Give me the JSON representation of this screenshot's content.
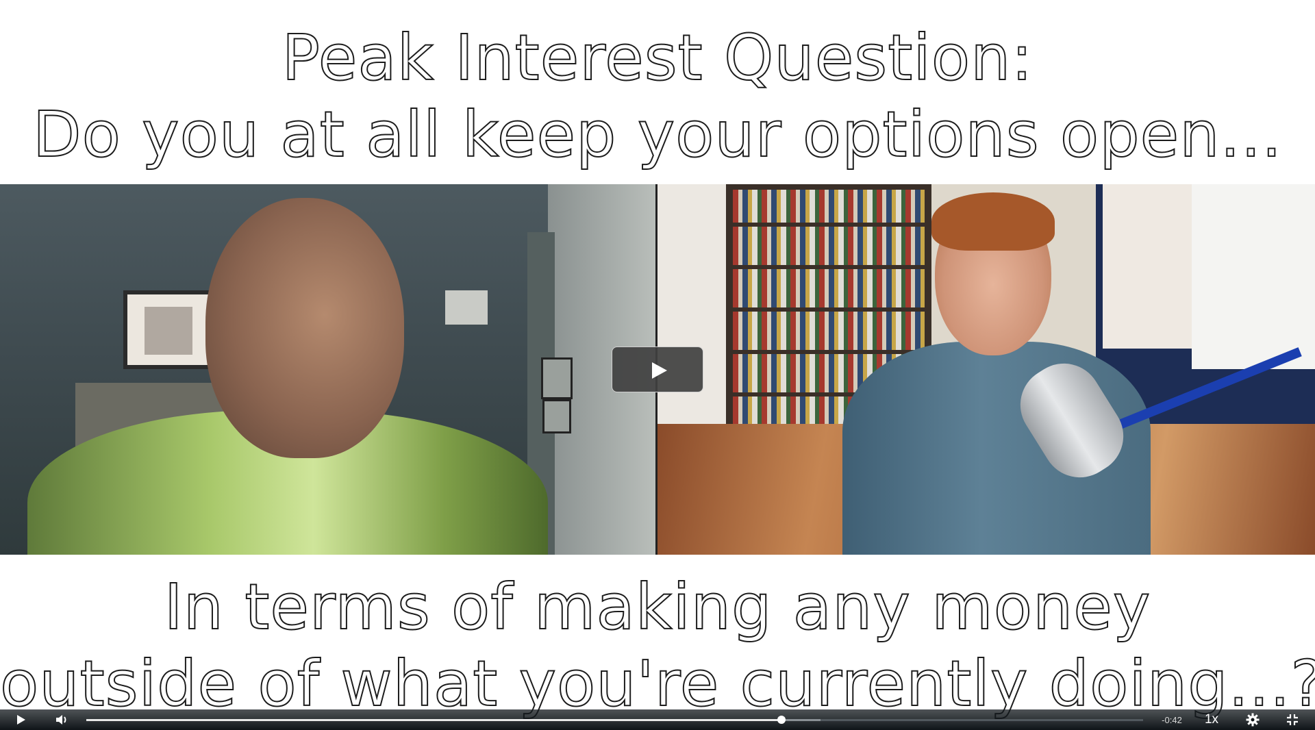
{
  "slide": {
    "title_line1": "Peak Interest Question:",
    "title_line2": "Do you at all keep your options open...",
    "caption_line1": "In terms of making any money",
    "caption_line2": "outside of what you're currently doing...?"
  },
  "player": {
    "big_play_icon": "play-icon",
    "controls": {
      "play_icon": "play-icon",
      "volume_icon": "volume-icon",
      "time_remaining": "-0:42",
      "speed_label": "1x",
      "settings_icon": "gear-icon",
      "fullscreen_icon": "exit-fullscreen-icon"
    },
    "progress": {
      "played_fraction": 0.658,
      "buffered_fraction": 0.695
    }
  },
  "colors": {
    "text_outline": "#1c1c1c",
    "control_bar_bg": "#0f1418",
    "progress_played": "#e8e8e8"
  }
}
